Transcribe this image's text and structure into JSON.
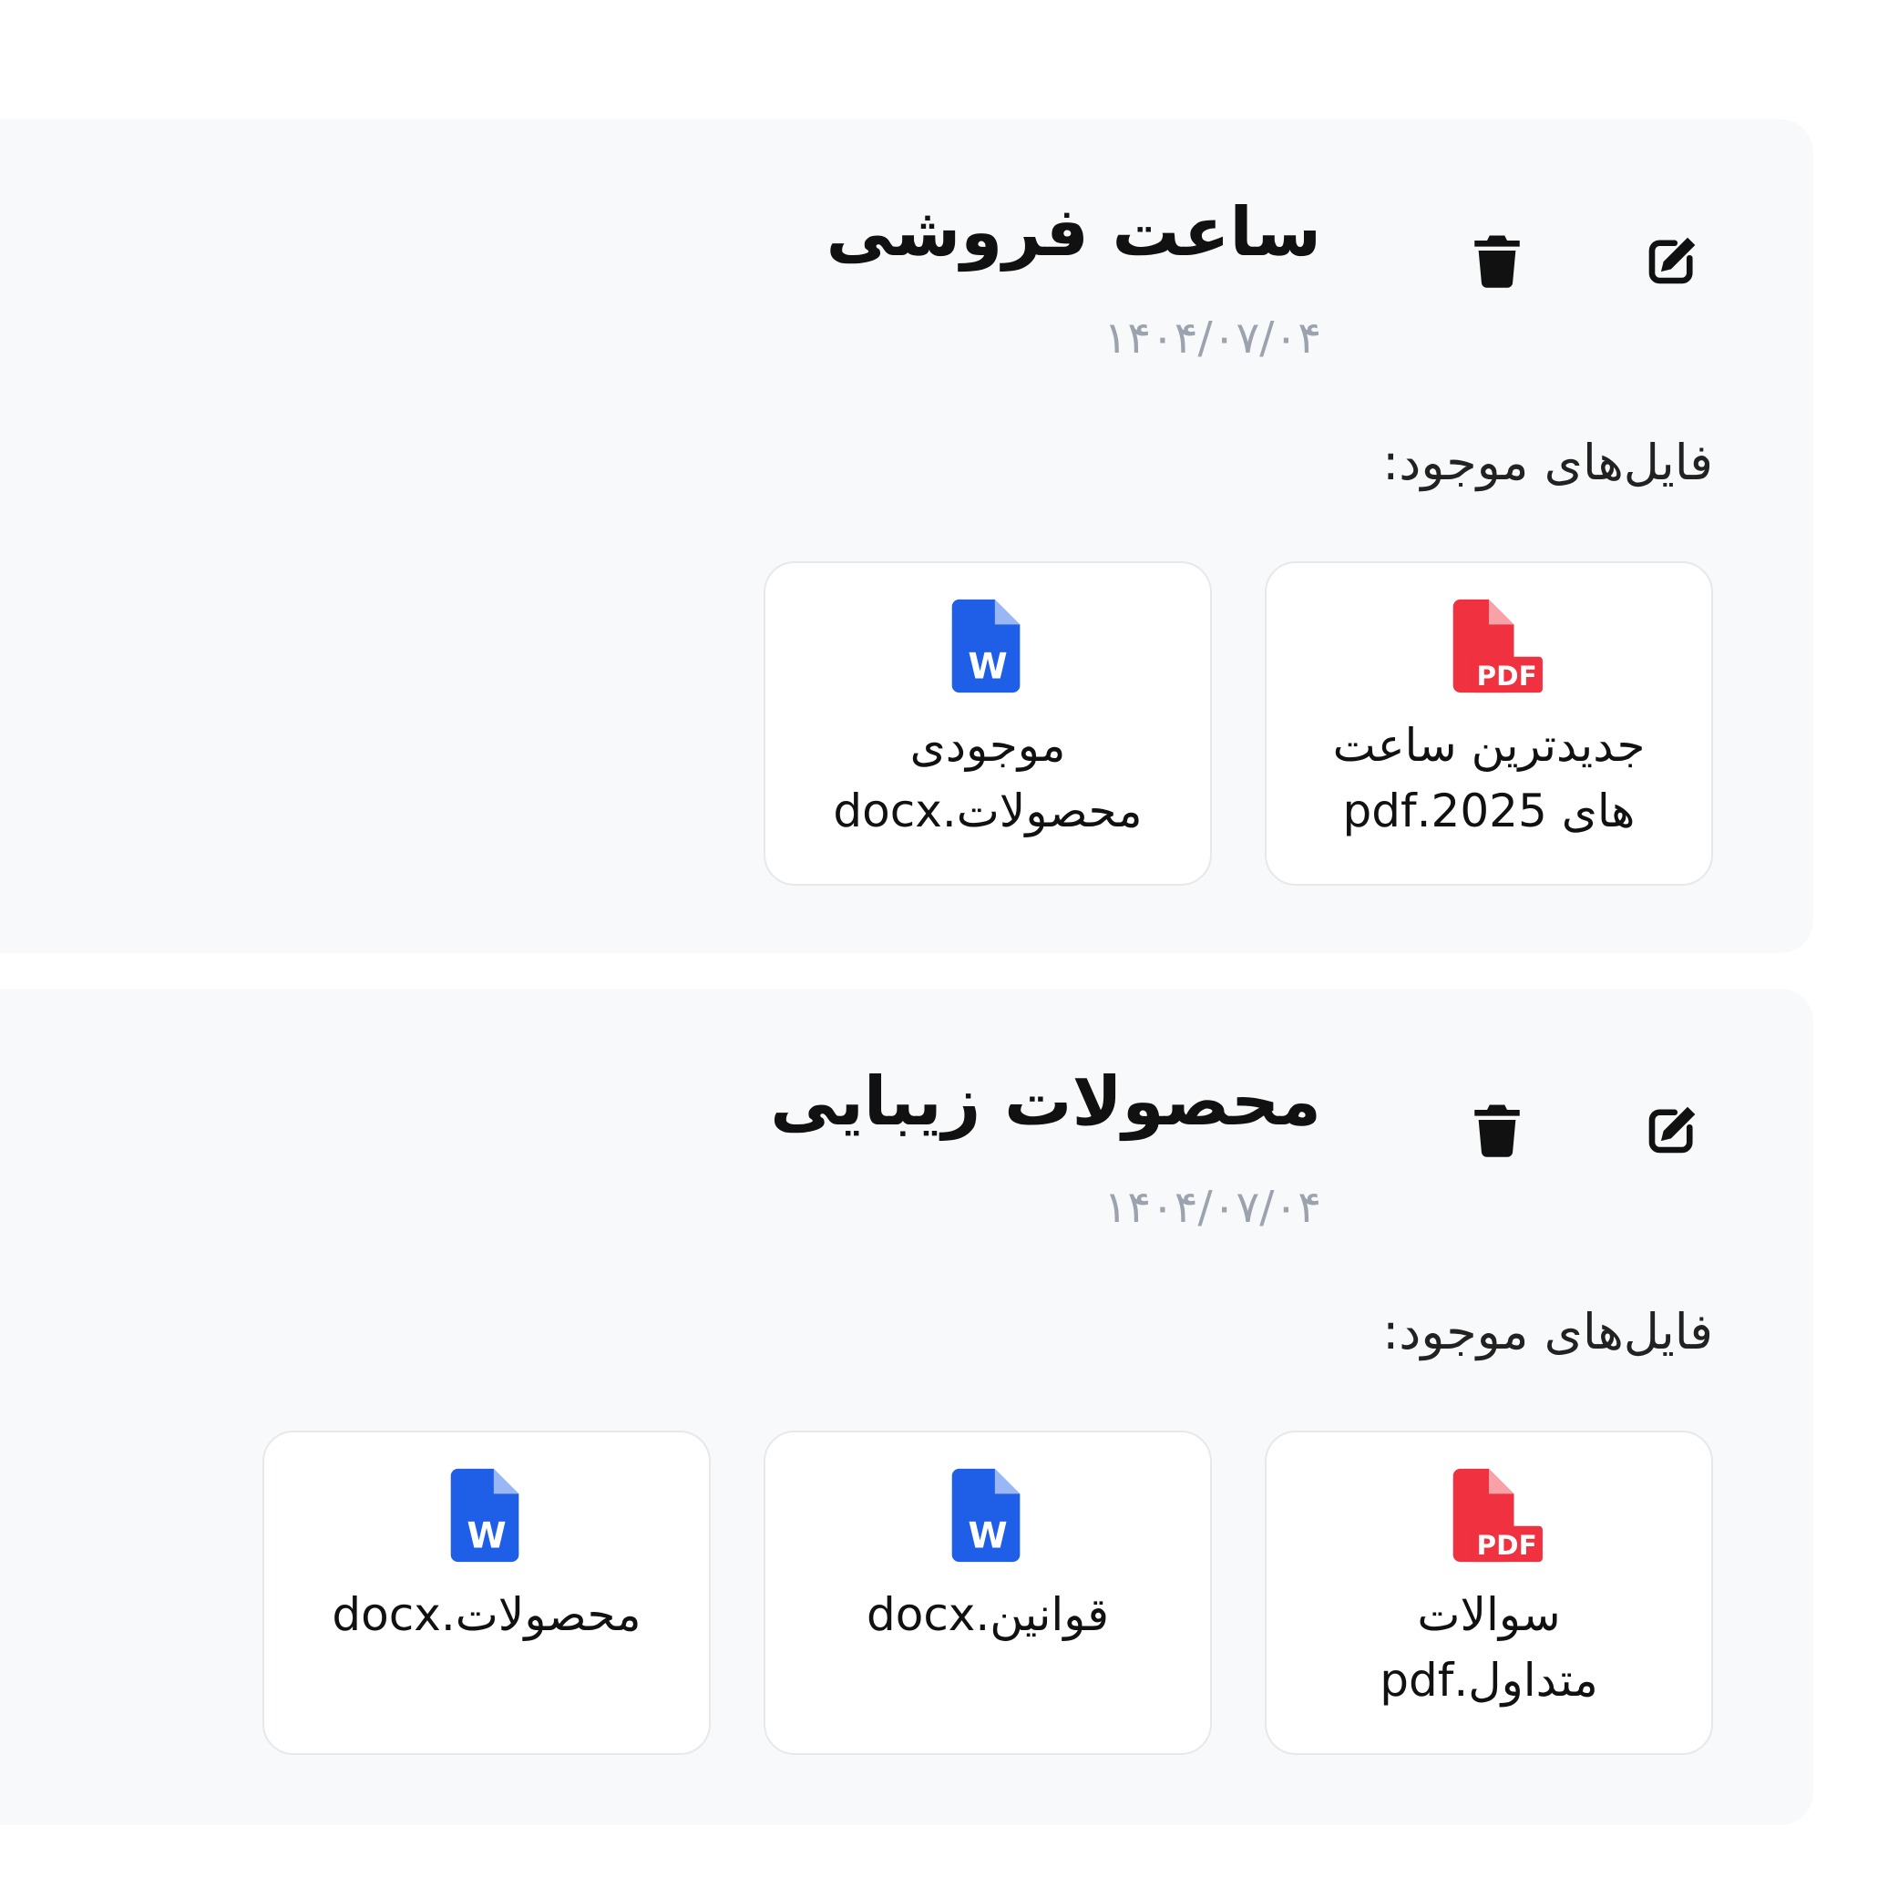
{
  "cards": [
    {
      "title": "ساعت فروشی",
      "date": "۱۴۰۴/۰۷/۰۴",
      "files_label": "فایل‌های موجود:",
      "files": [
        {
          "name": "جدیدترین ساعت های 2025.pdf",
          "type": "pdf",
          "icon": "pdf-file-icon"
        },
        {
          "name": "موجودی محصولات.docx",
          "type": "docx",
          "icon": "word-file-icon"
        }
      ]
    },
    {
      "title": "محصولات زیبایی",
      "date": "۱۴۰۴/۰۷/۰۴",
      "files_label": "فایل‌های موجود:",
      "files": [
        {
          "name": "سوالات متداول.pdf",
          "type": "pdf",
          "icon": "pdf-file-icon"
        },
        {
          "name": "قوانین.docx",
          "type": "docx",
          "icon": "word-file-icon"
        },
        {
          "name": "محصولات.docx",
          "type": "docx",
          "icon": "word-file-icon"
        }
      ]
    }
  ],
  "icons": {
    "edit": "edit-icon",
    "delete": "trash-icon"
  },
  "colors": {
    "card_background": "#f8f9fb",
    "tile_background": "#ffffff",
    "tile_border": "#e6e8ec",
    "pdf": "#f0313f",
    "word": "#1f5fe8",
    "date_text": "#9ca3af"
  }
}
